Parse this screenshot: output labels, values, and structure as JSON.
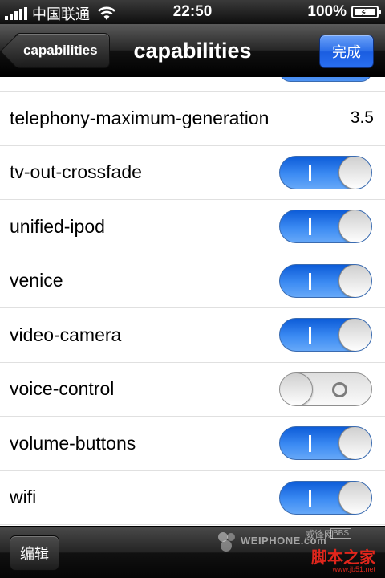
{
  "status_bar": {
    "carrier": "中国联通",
    "time": "22:50",
    "battery": "100%"
  },
  "nav": {
    "back_label": "capabilities",
    "title": "capabilities",
    "done_label": "完成"
  },
  "rows": [
    {
      "label": "telephony-maximum-generation",
      "value": "3.5"
    },
    {
      "label": "tv-out-crossfade",
      "toggle": "on"
    },
    {
      "label": "unified-ipod",
      "toggle": "on"
    },
    {
      "label": "venice",
      "toggle": "on"
    },
    {
      "label": "video-camera",
      "toggle": "on"
    },
    {
      "label": "voice-control",
      "toggle": "off"
    },
    {
      "label": "volume-buttons",
      "toggle": "on"
    },
    {
      "label": "wifi",
      "toggle": "on"
    }
  ],
  "toolbar": {
    "edit_label": "编辑"
  },
  "watermark": {
    "brand": "WEIPHONE.com",
    "cn": "威锋网",
    "bbs": "BBS",
    "site": "脚本之家",
    "url": "www.jb51.net"
  },
  "colors": {
    "toggle_on": "#2f7cf0",
    "done_button": "#2b6ee8",
    "watermark_red": "#e0261c"
  },
  "icons": [
    "signal-bars-icon",
    "wifi-icon",
    "battery-icon",
    "toggle-on-icon",
    "toggle-off-icon",
    "weiphone-logo-icon"
  ]
}
